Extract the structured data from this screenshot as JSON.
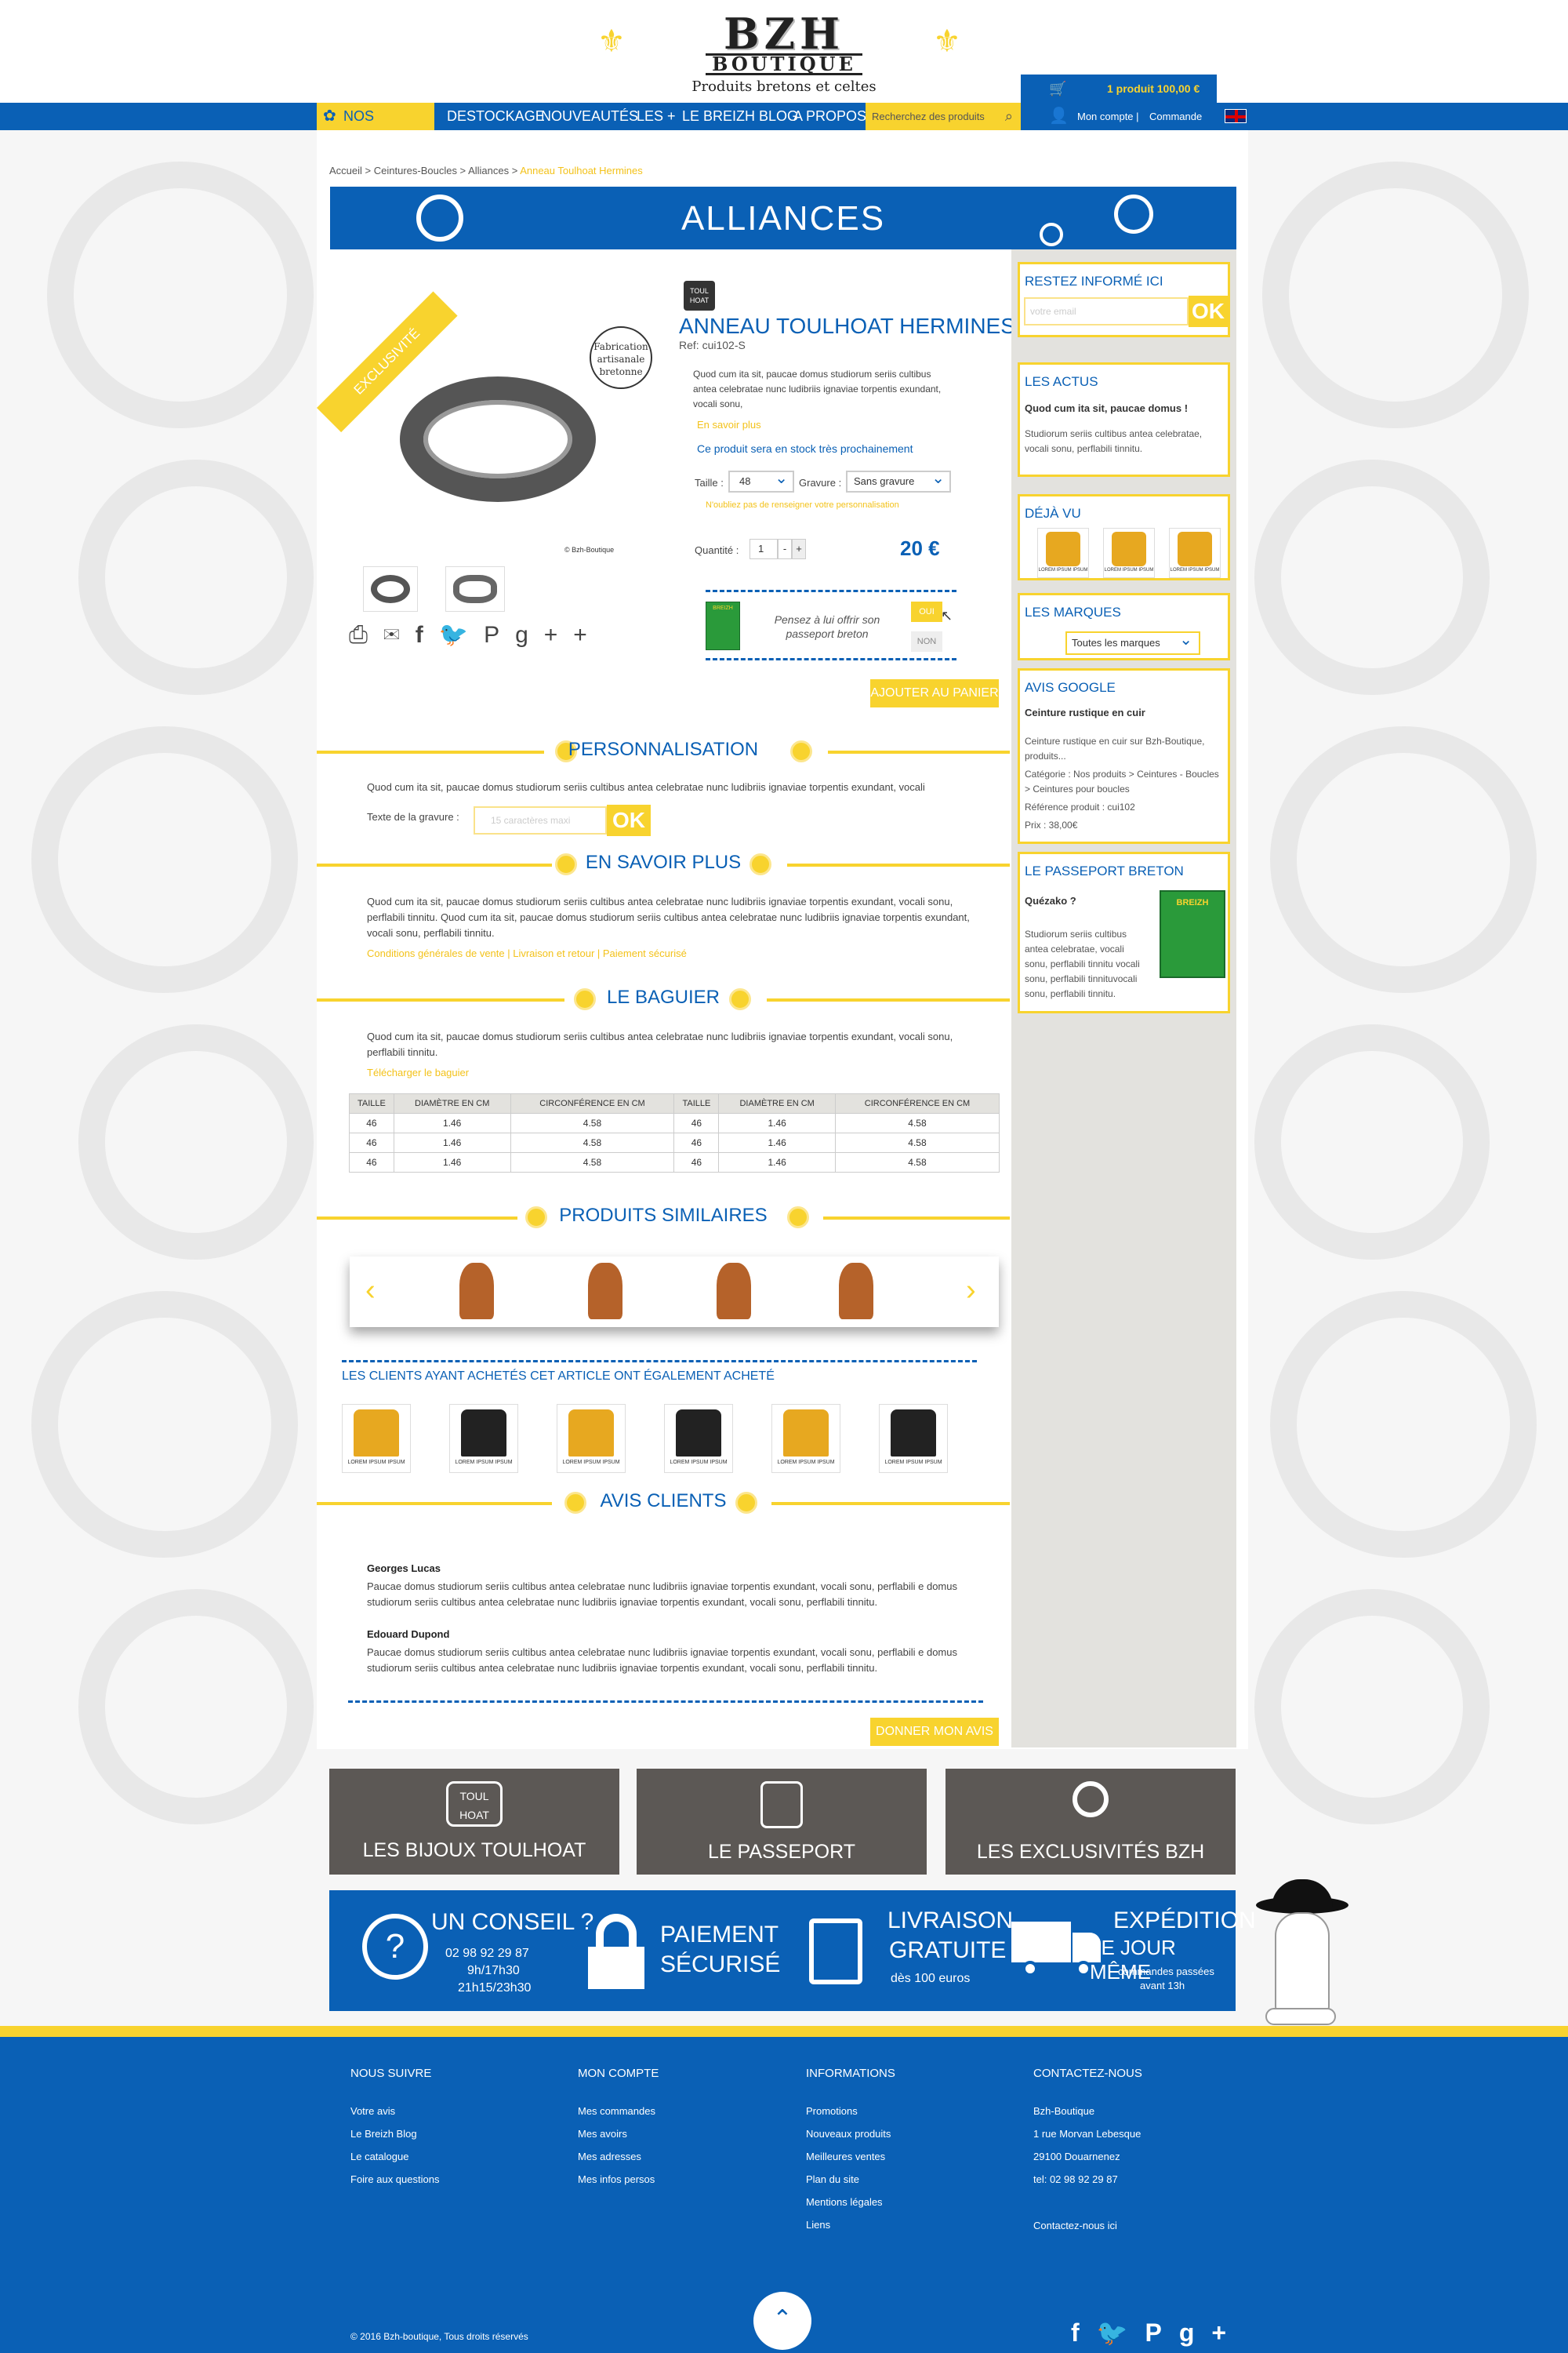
{
  "logo": {
    "line1": "BZH",
    "line2": "BOUTIQUE",
    "tagline": "Produits bretons et celtes"
  },
  "cart": {
    "label": "1 produit 100,00 €"
  },
  "account": {
    "my_account": "Mon compte |",
    "order": "Commande"
  },
  "nav": {
    "items": [
      "NOS PRODUITS",
      "DESTOCKAGE",
      "NOUVEAUTÉS",
      "LES +",
      "LE BREIZH BLOG",
      "A PROPOS"
    ],
    "search_placeholder": "Recherchez des produits"
  },
  "breadcrumb": {
    "items": [
      "Accueil > ",
      "Ceintures-Boucles > ",
      "Alliances > "
    ],
    "current": "Anneau Toulhoat Hermines"
  },
  "banner": {
    "title": "ALLIANCES"
  },
  "product": {
    "badge": "EXCLUSIVITÉ",
    "seal": "Fabrication artisanale bretonne",
    "name": "ANNEAU TOULHOAT HERMINES",
    "ref": "Ref: cui102-S",
    "description": "Quod cum ita sit, paucae domus studiorum seriis cultibus antea celebratae nunc ludibriis ignaviae torpentis exundant, vocali sonu,",
    "more_link": "En savoir plus",
    "stock": "Ce produit sera en stock très prochainement",
    "size_label": "Taille :",
    "size_value": "48",
    "engraving_label": "Gravure :",
    "engraving_value": "Sans gravure",
    "notice": "N'oubliez pas de renseigner votre personnalisation",
    "qty_label": "Quantité :",
    "qty_value": "1",
    "qty_minus": "-",
    "qty_plus": "+",
    "price": "20 €",
    "passport_text": "Pensez à lui offrir son passeport breton",
    "oui": "OUI",
    "non": "NON",
    "add_to_cart": "AJOUTER AU PANIER",
    "passport_cover": "BREIZH",
    "watermark": "© Bzh-Boutique"
  },
  "sections": {
    "personnalisation": {
      "title": "PERSONNALISATION",
      "text": "Quod cum ita sit, paucae domus studiorum seriis cultibus antea celebratae nunc ludibriis ignaviae torpentis exundant, vocali",
      "field_label": "Texte de la gravure :",
      "field_placeholder": "15 caractères maxi",
      "ok": "OK"
    },
    "savoir": {
      "title": "EN SAVOIR PLUS",
      "text": "Quod cum ita sit, paucae domus studiorum seriis cultibus antea celebratae nunc ludibriis ignaviae torpentis exundant, vocali sonu, perflabili tinnitu. Quod cum ita sit, paucae domus studiorum seriis cultibus antea celebratae nunc ludibriis ignaviae torpentis exundant, vocali sonu, perflabili tinnitu.",
      "links": "Conditions générales de vente | Livraison et retour | Paiement sécurisé"
    },
    "baguier": {
      "title": "LE BAGUIER",
      "text": "Quod cum ita sit, paucae domus studiorum seriis cultibus antea celebratae nunc ludibriis ignaviae torpentis exundant, vocali sonu, perflabili tinnitu.",
      "download": "Télécharger le baguier",
      "headers": [
        "TAILLE",
        "DIAMÈTRE EN CM",
        "CIRCONFÉRENCE EN CM",
        "TAILLE",
        "DIAMÈTRE EN CM",
        "CIRCONFÉRENCE EN CM"
      ],
      "rows": [
        [
          "46",
          "1.46",
          "4.58",
          "46",
          "1.46",
          "4.58"
        ],
        [
          "46",
          "1.46",
          "4.58",
          "46",
          "1.46",
          "4.58"
        ],
        [
          "46",
          "1.46",
          "4.58",
          "46",
          "1.46",
          "4.58"
        ]
      ]
    },
    "similaires": {
      "title": "PRODUITS SIMILAIRES"
    },
    "also_bought": {
      "title": "LES CLIENTS AYANT ACHETÉS CET ARTICLE ONT ÉGALEMENT ACHETÉ",
      "caption": "LOREM IPSUM IPSUM"
    },
    "avis": {
      "title": "AVIS CLIENTS",
      "reviews": [
        {
          "name": "Georges Lucas",
          "text": "Paucae domus studiorum seriis cultibus antea celebratae nunc ludibriis ignaviae torpentis exundant, vocali sonu, perflabili e domus studiorum seriis cultibus antea celebratae nunc ludibriis ignaviae torpentis exundant, vocali sonu, perflabili tinnitu."
        },
        {
          "name": "Edouard Dupond",
          "text": "Paucae domus studiorum seriis cultibus antea celebratae nunc ludibriis ignaviae torpentis exundant, vocali sonu, perflabili e domus studiorum seriis cultibus antea celebratae nunc ludibriis ignaviae torpentis exundant, vocali sonu, perflabili tinnitu."
        }
      ],
      "button": "DONNER MON AVIS"
    }
  },
  "sidebar": {
    "newsletter": {
      "title": "RESTEZ INFORMÉ ICI",
      "placeholder": "votre email",
      "ok": "OK"
    },
    "actus": {
      "title": "LES ACTUS",
      "headline": "Quod cum ita sit, paucae domus !",
      "text": "Studiorum seriis cultibus antea celebratae, vocali sonu, perflabili tinnitu."
    },
    "deja_vu": {
      "title": "DÉJÀ VU",
      "caption": "LOREM IPSUM IPSUM"
    },
    "marques": {
      "title": "LES MARQUES",
      "select": "Toutes les marques"
    },
    "google": {
      "title": "AVIS GOOGLE",
      "headline": "Ceinture rustique en cuir",
      "lines": [
        "Ceinture rustique en cuir sur Bzh-Boutique, produits...",
        "Catégorie : Nos produits > Ceintures - Boucles > Ceintures pour boucles",
        "Référence produit : cui102",
        "Prix : 38,00€"
      ]
    },
    "passeport": {
      "title": "LE PASSEPORT BRETON",
      "headline": "Quézako ?",
      "text": "Studiorum seriis cultibus antea celebratae, vocali sonu, perflabili tinnitu vocali sonu, perflabili tinnituvocali sonu, perflabili tinnitu."
    }
  },
  "tiles": [
    {
      "label": "LES BIJOUX TOULHOAT",
      "icon_text": "TOUL HOAT"
    },
    {
      "label": "LE PASSEPORT"
    },
    {
      "label": "LES EXCLUSIVITÉS BZH"
    }
  ],
  "services": {
    "conseil": {
      "title": "UN CONSEIL ?",
      "phone": "02 98 92 29 87",
      "hours1": "9h/17h30",
      "hours2": "21h15/23h30"
    },
    "paiement": {
      "line1": "PAIEMENT",
      "line2": "SÉCURISÉ"
    },
    "livraison": {
      "line1": "LIVRAISON",
      "line2": "GRATUITE",
      "sub": "dès 100 euros"
    },
    "expedition": {
      "line1": "EXPÉDITION",
      "line2": "LE JOUR MÊME",
      "sub1": "commandes passées",
      "sub2": "avant 13h"
    }
  },
  "footer": {
    "cols": [
      {
        "title": "NOUS SUIVRE",
        "items": [
          "Votre avis",
          "Le Breizh Blog",
          "Le catalogue",
          "Foire aux questions"
        ]
      },
      {
        "title": "MON COMPTE",
        "items": [
          "Mes commandes",
          "Mes avoirs",
          "Mes adresses",
          "Mes infos persos"
        ]
      },
      {
        "title": "INFORMATIONS",
        "items": [
          "Promotions",
          "Nouveaux  produits",
          "Meilleures ventes",
          "Plan du site",
          "Mentions légales",
          "Liens"
        ]
      },
      {
        "title": "CONTACTEZ-NOUS",
        "items": [
          "Bzh-Boutique",
          "1 rue Morvan Lebesque",
          "29100 Douarnenez",
          "tel: 02 98 92 29 87",
          "",
          "Contactez-nous ici"
        ]
      }
    ],
    "copyright": "© 2016  Bzh-boutique, Tous droits réservés"
  },
  "colors": {
    "blue": "#0a60b5",
    "yellow": "#f8d32e",
    "grey": "#5c5855"
  }
}
